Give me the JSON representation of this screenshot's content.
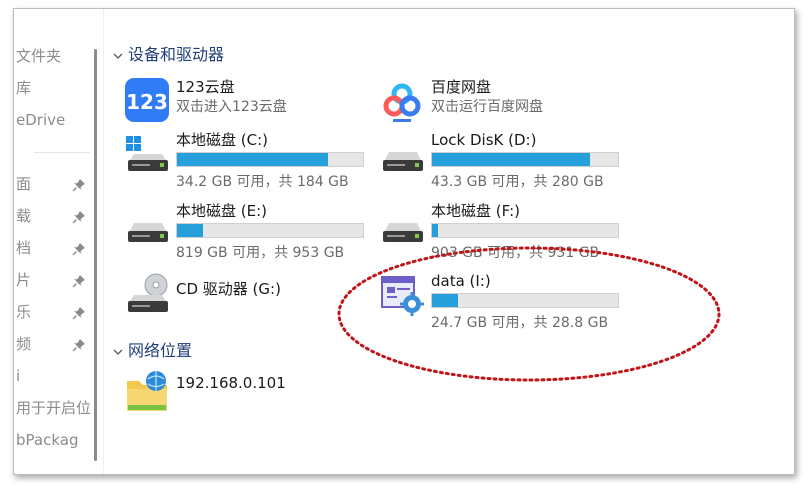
{
  "nav": {
    "items": [
      {
        "label": "文件夹",
        "pinned": false
      },
      {
        "label": "库",
        "pinned": false
      },
      {
        "label": "eDrive",
        "pinned": false
      },
      {
        "label": "面",
        "pinned": true
      },
      {
        "label": "载",
        "pinned": true
      },
      {
        "label": "档",
        "pinned": true
      },
      {
        "label": "片",
        "pinned": true
      },
      {
        "label": "乐",
        "pinned": true
      },
      {
        "label": "频",
        "pinned": true
      },
      {
        "label": "i",
        "pinned": false
      },
      {
        "label": "用于开启位",
        "pinned": false
      },
      {
        "label": "bPackag",
        "pinned": false
      }
    ]
  },
  "devices": {
    "header": "设备和驱动器",
    "cloud": [
      {
        "title": "123云盘",
        "subtitle": "双击进入123云盘",
        "icon": "cloud-123-icon"
      },
      {
        "title": "百度网盘",
        "subtitle": "双击运行百度网盘",
        "icon": "baidu-netdisk-icon"
      }
    ],
    "drives": [
      {
        "title": "本地磁盘 (C:)",
        "usage": 0.81,
        "size": "34.2 GB 可用，共 184 GB",
        "icon": "windows-drive-icon"
      },
      {
        "title": "Lock DisK (D:)",
        "usage": 0.85,
        "size": "43.3 GB 可用，共 280 GB",
        "icon": "hard-drive-icon"
      },
      {
        "title": "本地磁盘 (E:)",
        "usage": 0.14,
        "size": "819 GB 可用，共 953 GB",
        "icon": "hard-drive-icon"
      },
      {
        "title": "本地磁盘 (F:)",
        "usage": 0.03,
        "size": "903 GB 可用，共 931 GB",
        "icon": "hard-drive-icon"
      },
      {
        "title": "data (I:)",
        "usage": 0.14,
        "size": "24.7 GB 可用，共 28.8 GB",
        "icon": "settings-drive-icon"
      }
    ],
    "cd": {
      "title": "CD 驱动器 (G:)",
      "icon": "cd-drive-icon"
    }
  },
  "network": {
    "header": "网络位置",
    "items": [
      {
        "title": "192.168.0.101",
        "icon": "network-folder-icon"
      }
    ]
  },
  "colors": {
    "bar_fill": "#26a0da",
    "bar_bg": "#e6e6e6",
    "annotation": "#c0161a",
    "header": "#1f3f7a"
  }
}
